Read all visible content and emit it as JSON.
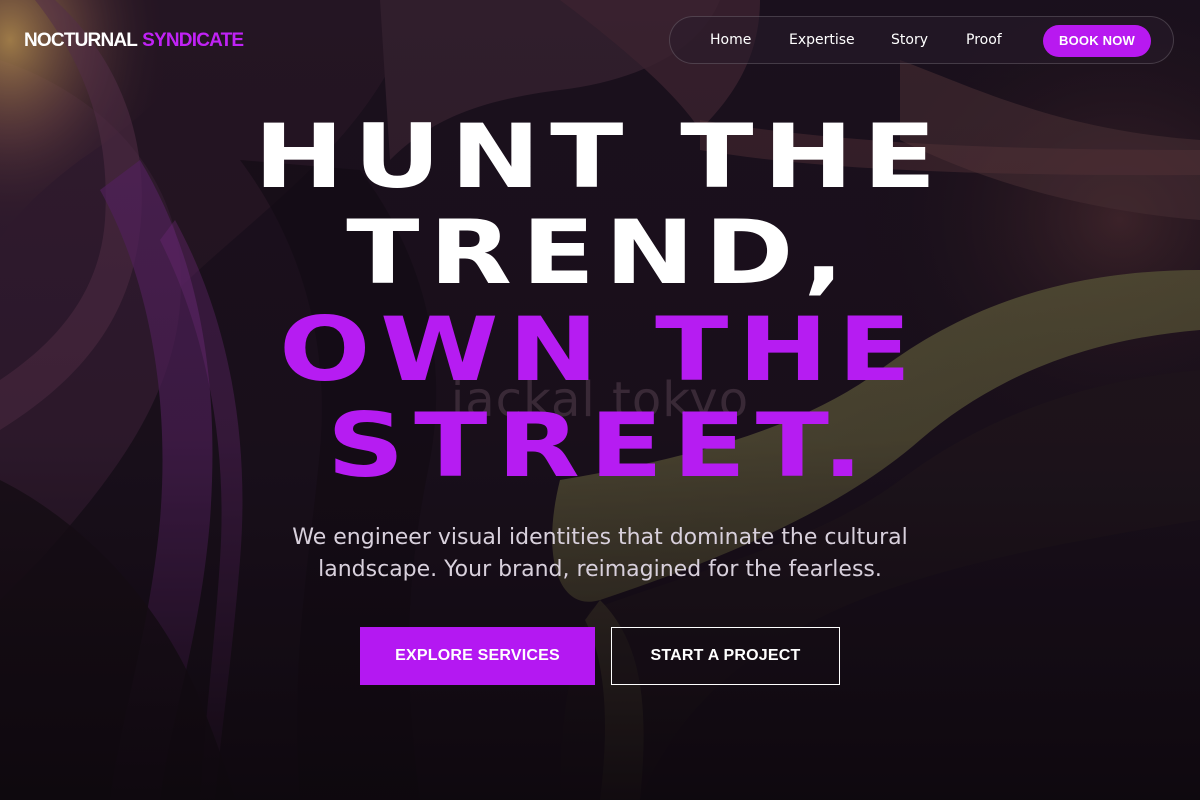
{
  "header": {
    "logo_part1": "NOCTURNAL",
    "logo_part2": "SYNDICATE",
    "nav": {
      "home": "Home",
      "expertise": "Expertise",
      "story": "Story",
      "proof": "Proof"
    },
    "cta_label": "BOOK NOW"
  },
  "hero": {
    "line1": "HUNT THE",
    "line2": "TREND,",
    "line3": "OWN THE",
    "line4": "STREET.",
    "background_watermark": "jackal tokyo",
    "subtitle": "We engineer visual identities that dominate the cultural landscape. Your brand, reimagined for the fearless.",
    "primary_button": "EXPLORE SERVICES",
    "secondary_button": "START A PROJECT"
  },
  "colors": {
    "accent": "#b819f0",
    "background": "#120b14",
    "text": "#ffffff",
    "subtitle_text": "#d8d0dc"
  }
}
